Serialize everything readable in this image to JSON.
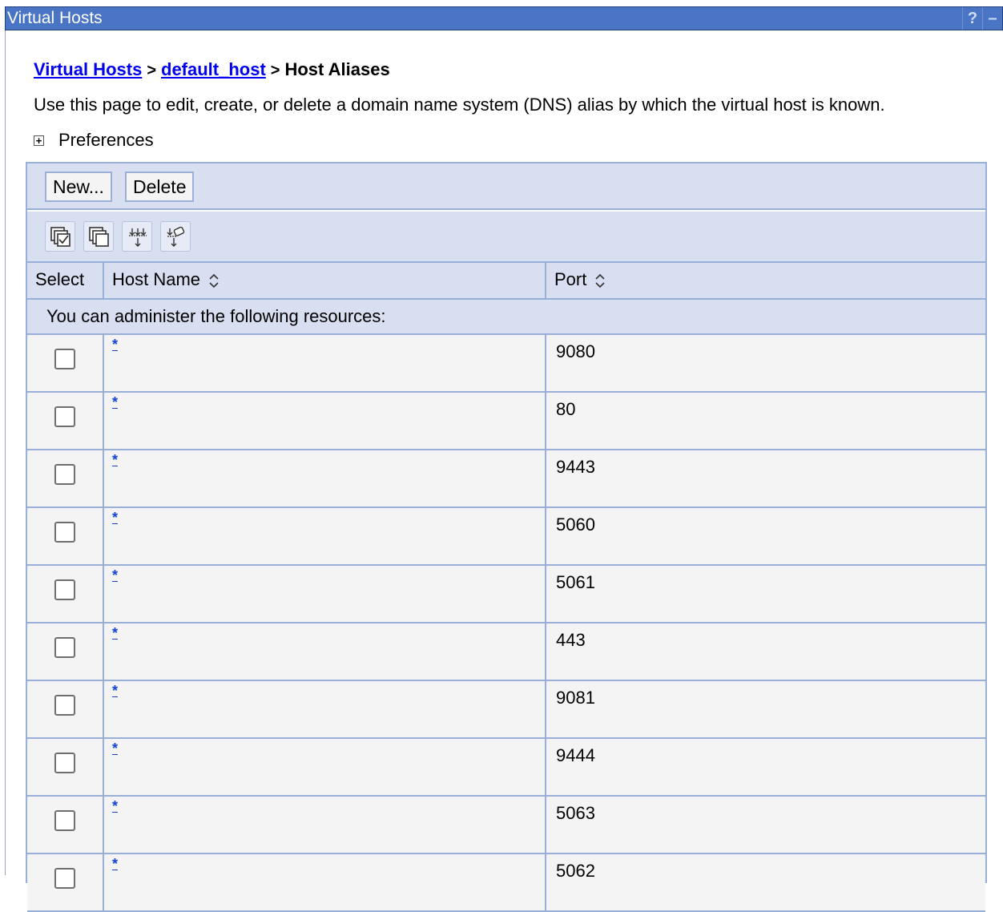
{
  "window": {
    "title": "Virtual Hosts",
    "help_label": "?",
    "minimize_label": "–"
  },
  "breadcrumb": {
    "items": [
      "Virtual Hosts",
      "default_host",
      "Host Aliases"
    ],
    "separator": ">"
  },
  "description": "Use this page to edit, create, or delete a domain name system (DNS) alias by which the virtual host is known.",
  "preferences": {
    "label": "Preferences",
    "expand_icon": "plus-icon"
  },
  "toolbar": {
    "new_label": "New...",
    "delete_label": "Delete",
    "icons": [
      "select-all-icon",
      "deselect-all-icon",
      "show-filter-icon",
      "clear-filter-icon"
    ]
  },
  "table": {
    "columns": [
      "Select",
      "Host Name",
      "Port"
    ],
    "notice": "You can administer the following resources:",
    "rows": [
      {
        "host": "*",
        "port": "9080"
      },
      {
        "host": "*",
        "port": "80"
      },
      {
        "host": "*",
        "port": "9443"
      },
      {
        "host": "*",
        "port": "5060"
      },
      {
        "host": "*",
        "port": "5061"
      },
      {
        "host": "*",
        "port": "443"
      },
      {
        "host": "*",
        "port": "9081"
      },
      {
        "host": "*",
        "port": "9444"
      },
      {
        "host": "*",
        "port": "5063"
      },
      {
        "host": "*",
        "port": "5062"
      }
    ]
  },
  "colors": {
    "title_bar": "#4a74c4",
    "header_bg": "#d8dff0",
    "row_bg": "#f4f4f4",
    "link": "#0000ee"
  }
}
